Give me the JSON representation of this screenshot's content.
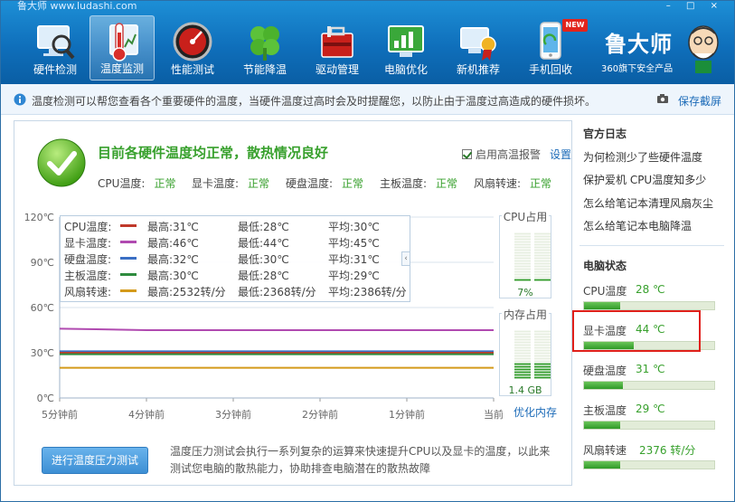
{
  "app": {
    "title": "鲁大师 www.ludashi.com"
  },
  "window_controls": [
    "–",
    "□",
    "×"
  ],
  "toolbar": {
    "items": [
      {
        "label": "硬件检测",
        "icon": "magnifier-monitor-icon",
        "active": false
      },
      {
        "label": "温度监测",
        "icon": "thermometer-icon",
        "active": true
      },
      {
        "label": "性能测试",
        "icon": "speedometer-icon",
        "active": false
      },
      {
        "label": "节能降温",
        "icon": "clover-leaf-icon",
        "active": false
      },
      {
        "label": "驱动管理",
        "icon": "toolbox-icon",
        "active": false
      },
      {
        "label": "电脑优化",
        "icon": "chart-screen-icon",
        "active": false
      },
      {
        "label": "新机推荐",
        "icon": "award-computer-icon",
        "active": false
      },
      {
        "label": "手机回收",
        "icon": "phone-recycle-icon",
        "active": false
      }
    ],
    "new_badge": "NEW"
  },
  "brand": {
    "name": "鲁大师",
    "subtitle": "360旗下安全产品"
  },
  "infobar": {
    "text": "温度检测可以帮您查看各个重要硬件的温度，当硬件温度过高时会及时提醒您，以防止由于温度过高造成的硬件损坏。",
    "screenshot_label": "保存截屏"
  },
  "status": {
    "headline": "目前各硬件温度均正常，散热情况良好",
    "alarm_label": "启用高温报警",
    "alarm_checked": true,
    "settings_label": "设置",
    "summary": [
      {
        "label": "CPU温度:",
        "value": "正常"
      },
      {
        "label": "显卡温度:",
        "value": "正常"
      },
      {
        "label": "硬盘温度:",
        "value": "正常"
      },
      {
        "label": "主板温度:",
        "value": "正常"
      },
      {
        "label": "风扇转速:",
        "value": "正常"
      }
    ]
  },
  "legend": [
    {
      "name": "CPU温度:",
      "color": "#c0392b",
      "max": "最高:31℃",
      "min": "最低:28℃",
      "avg": "平均:30℃"
    },
    {
      "name": "显卡温度:",
      "color": "#b04ab0",
      "max": "最高:46℃",
      "min": "最低:44℃",
      "avg": "平均:45℃"
    },
    {
      "name": "硬盘温度:",
      "color": "#3a6fc4",
      "max": "最高:32℃",
      "min": "最低:30℃",
      "avg": "平均:31℃"
    },
    {
      "name": "主板温度:",
      "color": "#2e8b3e",
      "max": "最高:30℃",
      "min": "最低:28℃",
      "avg": "平均:29℃"
    },
    {
      "name": "风扇转速:",
      "color": "#d49a1a",
      "max": "最高:2532转/分",
      "min": "最低:2368转/分",
      "avg": "平均:2386转/分"
    }
  ],
  "chart_data": {
    "type": "line",
    "title": "",
    "xlabel": "",
    "ylabel": "",
    "yticks": [
      "120℃",
      "90℃",
      "60℃",
      "30℃",
      "0℃"
    ],
    "ylim": [
      0,
      120
    ],
    "xticks": [
      "5分钟前",
      "4分钟前",
      "3分钟前",
      "2分钟前",
      "1分钟前",
      "当前"
    ],
    "xlim": [
      -5,
      0
    ],
    "grid": true,
    "series": [
      {
        "name": "显卡温度",
        "color": "#b04ab0",
        "x": [
          -5,
          -4.5,
          -4,
          -3.5,
          -3,
          -2.5,
          -2,
          -1.5,
          -1,
          -0.5,
          0
        ],
        "y": [
          46,
          45.5,
          45,
          45,
          45,
          45,
          45,
          45,
          45,
          45,
          45
        ]
      },
      {
        "name": "硬盘温度",
        "color": "#3a6fc4",
        "x": [
          -5,
          0
        ],
        "y": [
          31,
          31
        ]
      },
      {
        "name": "CPU温度",
        "color": "#c0392b",
        "x": [
          -5,
          0
        ],
        "y": [
          30,
          30
        ]
      },
      {
        "name": "主板温度",
        "color": "#2e8b3e",
        "x": [
          -5,
          0
        ],
        "y": [
          29,
          29
        ]
      },
      {
        "name": "风扇转速",
        "color": "#d49a1a",
        "x": [
          -5,
          0
        ],
        "y": [
          20,
          20
        ]
      }
    ]
  },
  "gauges": {
    "cpu": {
      "title": "CPU占用",
      "value": "7%",
      "level": 0.07
    },
    "mem": {
      "title": "内存占用",
      "value": "1.4 GB",
      "level": 0.35
    },
    "optimize_label": "优化内存"
  },
  "bottom": {
    "button_label": "进行温度压力测试",
    "description": "温度压力测试会执行一系列复杂的运算来快速提升CPU以及显卡的温度，以此来测试您电脑的散热能力，协助排查电脑潜在的散热故障"
  },
  "sidebar": {
    "news_title": "官方日志",
    "news": [
      "为何检测少了些硬件温度",
      "保护爱机 CPU温度知多少",
      "怎么给笔记本清理风扇灰尘",
      "怎么给笔记本电脑降温"
    ],
    "status_title": "电脑状态",
    "stats": [
      {
        "label": "CPU温度",
        "value": "28 ℃",
        "level": 0.28
      },
      {
        "label": "显卡温度",
        "value": "44 ℃",
        "level": 0.38
      },
      {
        "label": "硬盘温度",
        "value": "31 ℃",
        "level": 0.3
      },
      {
        "label": "主板温度",
        "value": "29 ℃",
        "level": 0.28
      },
      {
        "label": "风扇转速",
        "value": "2376 转/分",
        "level": 0.28
      }
    ]
  }
}
